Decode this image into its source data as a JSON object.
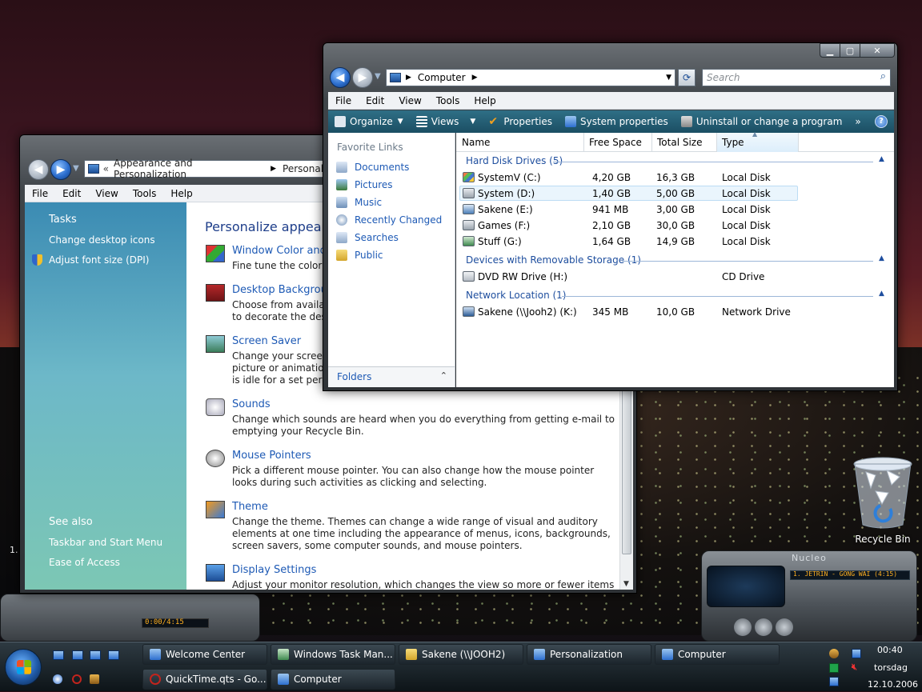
{
  "personalization": {
    "address": {
      "crumbs": [
        "Appearance and Personalization",
        "Personalization"
      ],
      "sep": "«"
    },
    "menu": [
      "File",
      "Edit",
      "View",
      "Tools",
      "Help"
    ],
    "tasks_title": "Tasks",
    "tasks": [
      "Change desktop icons",
      "Adjust font size (DPI)"
    ],
    "see_also_title": "See also",
    "see_also": [
      "Taskbar and Start Menu",
      "Ease of Access"
    ],
    "heading": "Personalize appearance and sounds",
    "items": [
      {
        "title": "Window Color and Appearance",
        "desc": "Fine tune the color and style of your windows."
      },
      {
        "title": "Desktop Background",
        "desc": "Choose from available backgrounds or colors or use one of your own pictures to decorate the desktop."
      },
      {
        "title": "Screen Saver",
        "desc": "Change your screen saver or adjust when it displays. A screen saver is a picture or animation that covers your screen and appears when your computer is idle for a set period of time."
      },
      {
        "title": "Sounds",
        "desc": "Change which sounds are heard when you do everything from getting e-mail to emptying your Recycle Bin."
      },
      {
        "title": "Mouse Pointers",
        "desc": "Pick a different mouse pointer. You can also change how the mouse pointer looks during such activities as clicking and selecting."
      },
      {
        "title": "Theme",
        "desc": "Change the theme. Themes can change a wide range of visual and auditory elements at one time including the appearance of menus, icons, backgrounds, screen savers, some computer sounds, and mouse pointers."
      },
      {
        "title": "Display Settings",
        "desc": "Adjust your monitor resolution, which changes the view so more or fewer items fit on the"
      }
    ]
  },
  "computer": {
    "address": "Computer",
    "search_placeholder": "Search",
    "menu": [
      "File",
      "Edit",
      "View",
      "Tools",
      "Help"
    ],
    "toolbar": [
      "Organize",
      "Views",
      "Properties",
      "System properties",
      "Uninstall or change a program"
    ],
    "toolbar_more": "»",
    "favorites_title": "Favorite Links",
    "favorites": [
      "Documents",
      "Pictures",
      "Music",
      "Recently Changed",
      "Searches",
      "Public"
    ],
    "folders_label": "Folders",
    "columns": [
      "Name",
      "Free Space",
      "Total Size",
      "Type"
    ],
    "groups": [
      {
        "label": "Hard Disk Drives (5)",
        "rows": [
          {
            "name": "SystemV (C:)",
            "free": "4,20 GB",
            "total": "16,3 GB",
            "type": "Local Disk"
          },
          {
            "name": "System (D:)",
            "free": "1,40 GB",
            "total": "5,00 GB",
            "type": "Local Disk"
          },
          {
            "name": "Sakene (E:)",
            "free": "941 MB",
            "total": "3,00 GB",
            "type": "Local Disk"
          },
          {
            "name": "Games (F:)",
            "free": "2,10 GB",
            "total": "30,0 GB",
            "type": "Local Disk"
          },
          {
            "name": "Stuff (G:)",
            "free": "1,64 GB",
            "total": "14,9 GB",
            "type": "Local Disk"
          }
        ]
      },
      {
        "label": "Devices with Removable Storage (1)",
        "rows": [
          {
            "name": "DVD RW Drive (H:)",
            "free": "",
            "total": "",
            "type": "CD Drive"
          }
        ]
      },
      {
        "label": "Network Location (1)",
        "rows": [
          {
            "name": "Sakene (\\\\Jooh2) (K:)",
            "free": "345 MB",
            "total": "10,0 GB",
            "type": "Network Drive"
          }
        ]
      }
    ]
  },
  "desktop": {
    "recycle_bin": "Recycle Bin"
  },
  "media_player": {
    "brand": "Nucleo",
    "track": "1. JETRIN - GONG WAI (4:15)",
    "time": "0:00/4:15",
    "left_digit": "1."
  },
  "taskbar": {
    "row1": [
      "Welcome Center",
      "Windows Task Man...",
      "Sakene (\\\\JOOH2)",
      "Personalization",
      "Computer"
    ],
    "row2": [
      "QuickTime.qts - Go...",
      "Computer"
    ],
    "clock": {
      "time": "00:40",
      "day": "torsdag",
      "date": "12.10.2006"
    }
  }
}
